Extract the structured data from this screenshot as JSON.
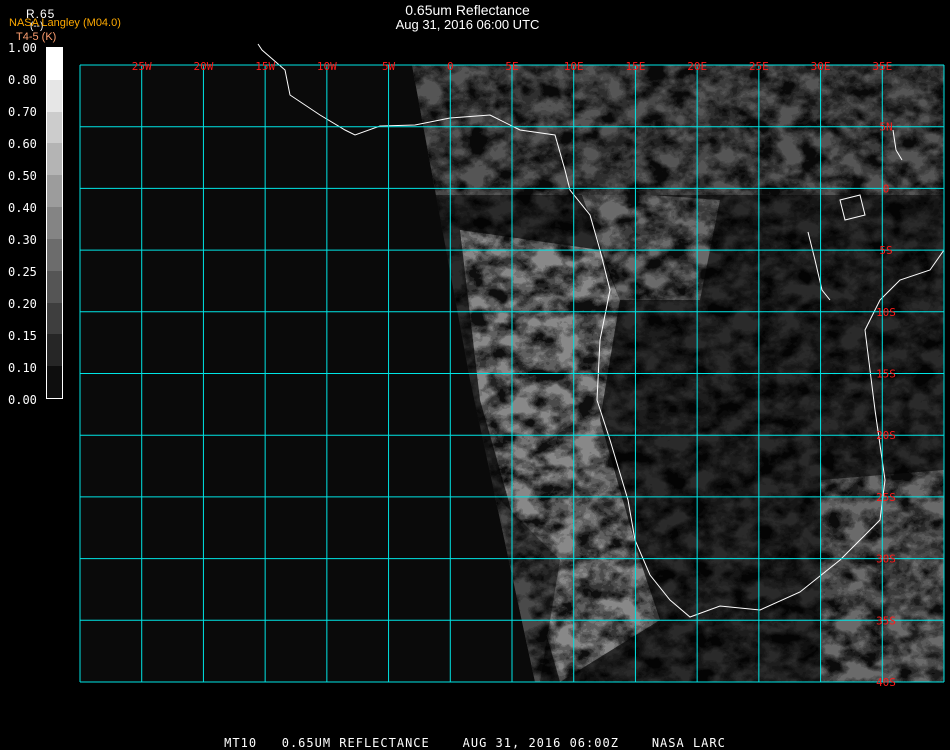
{
  "header": {
    "title": "0.65um Reflectance",
    "subtitle": "Aug 31, 2016 06:00 UTC",
    "product": "R.65",
    "product_unit": "(--)",
    "source": "NASA Langley (M04.0)",
    "secondary_product": "T4-5 (K)"
  },
  "colorbar": {
    "ticks": [
      "1.00",
      "0.80",
      "0.70",
      "0.60",
      "0.50",
      "0.40",
      "0.30",
      "0.25",
      "0.20",
      "0.15",
      "0.10",
      "0.00"
    ],
    "colors": [
      "#ffffff",
      "#e6e6e6",
      "#cccccc",
      "#b4b4b4",
      "#9c9c9c",
      "#848484",
      "#6c6c6c",
      "#555555",
      "#3e3e3e",
      "#262626",
      "#0e0e0e"
    ]
  },
  "map": {
    "lon_labels": [
      "25W",
      "20W",
      "15W",
      "10W",
      "5W",
      "0",
      "5E",
      "10E",
      "15E",
      "20E",
      "25E",
      "30E",
      "35E"
    ],
    "lat_labels": [
      "5N",
      "0",
      "5S",
      "10S",
      "15S",
      "20S",
      "25S",
      "30S",
      "35S",
      "40S"
    ],
    "grid_color": "#00e5e5",
    "label_color": "#ff1a1a"
  },
  "footer": "MT10   0.65UM REFLECTANCE    AUG 31, 2016 06:00Z    NASA LARC"
}
